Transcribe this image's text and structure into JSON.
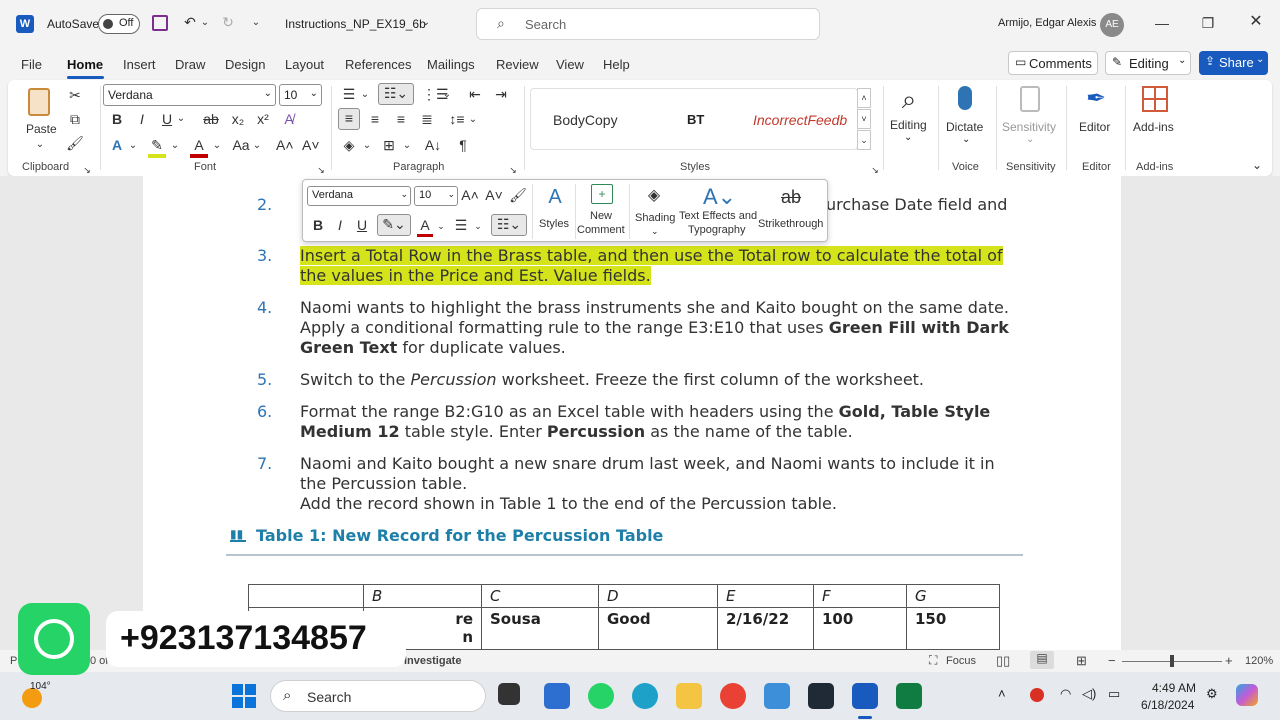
{
  "titlebar": {
    "autosave_label": "AutoSave",
    "autosave_state": "Off",
    "doc_title": "Instructions_NP_EX19_6b",
    "search_placeholder": "Search",
    "user_name": "Armijo, Edgar Alexis",
    "user_initials": "AE"
  },
  "menu": {
    "items": [
      "File",
      "Home",
      "Insert",
      "Draw",
      "Design",
      "Layout",
      "References",
      "Mailings",
      "Review",
      "View",
      "Help"
    ],
    "active": "Home",
    "comments_label": "Comments",
    "editing_label": "Editing",
    "share_label": "Share"
  },
  "ribbon": {
    "paste_label": "Paste",
    "clipboard_label": "Clipboard",
    "font_name": "Verdana",
    "font_size": "10",
    "font_label": "Font",
    "paragraph_label": "Paragraph",
    "styles": [
      "BodyCopy",
      "BT",
      "IncorrectFeedb"
    ],
    "styles_label": "Styles",
    "editing_btn": "Editing",
    "dictate_btn": "Dictate",
    "voice_label": "Voice",
    "sensitivity_btn": "Sensitivity",
    "sensitivity_label": "Sensitivity",
    "editor_btn": "Editor",
    "editor_label": "Editor",
    "addins_btn": "Add-ins",
    "addins_label": "Add-ins"
  },
  "minitoolbar": {
    "font_name": "Verdana",
    "font_size": "10",
    "styles_label": "Styles",
    "new_comment_line1": "New",
    "new_comment_line2": "Comment",
    "shading_label": "Shading",
    "text_effects_line1": "Text Effects and",
    "text_effects_line2": "Typography",
    "strikethrough_label": "Strikethrough"
  },
  "document": {
    "item2": {
      "num": "2.",
      "tail": "urchase Date field and"
    },
    "item3": {
      "num": "3.",
      "line1": "Insert a Total Row in the Brass table, and then use the Total row to calculate the total of",
      "line2": "the values in the Price and Est. Value fields."
    },
    "item4": {
      "num": "4.",
      "line1": "Naomi wants to highlight the brass instruments she and Kaito bought on the same date.",
      "line2a": "Apply a conditional formatting rule to the range E3:E10 that uses ",
      "line2b": "Green Fill with Dark",
      "line3a": "Green Text",
      "line3b": " for duplicate values."
    },
    "item5": {
      "num": "5.",
      "a": "Switch to the ",
      "b": "Percussion",
      "c": " worksheet. Freeze the first column of the worksheet."
    },
    "item6": {
      "num": "6.",
      "line1a": "Format the range B2:G10 as an Excel table with headers using the ",
      "line1b": "Gold, Table Style",
      "line2a": "Medium 12",
      "line2b": " table style. Enter ",
      "line2c": "Percussion",
      "line2d": " as the name of the table."
    },
    "item7": {
      "num": "7.",
      "line1": "Naomi and Kaito bought a new snare drum last week, and Naomi wants to include it in",
      "line2": "the Percussion table.",
      "line3": "Add the record shown in Table 1 to the end of the Percussion table."
    },
    "caption": "Table 1: New Record for the Percussion Table",
    "table": {
      "headers": [
        "",
        "B",
        "C",
        "D",
        "E",
        "F",
        "G"
      ],
      "row": [
        "",
        "re\nn",
        "Sousa",
        "Good",
        "2/16/22",
        "100",
        "150"
      ]
    }
  },
  "statusbar": {
    "left_fragment": "P",
    "page_fragment": "0 of",
    "investigate": "Investigate",
    "focus": "Focus",
    "zoom": "120%"
  },
  "overlay": {
    "phone": "+923137134857"
  },
  "taskbar": {
    "weather_temp": "104°",
    "search_placeholder": "Search",
    "time": "4:49 AM",
    "date": "6/18/2024"
  }
}
